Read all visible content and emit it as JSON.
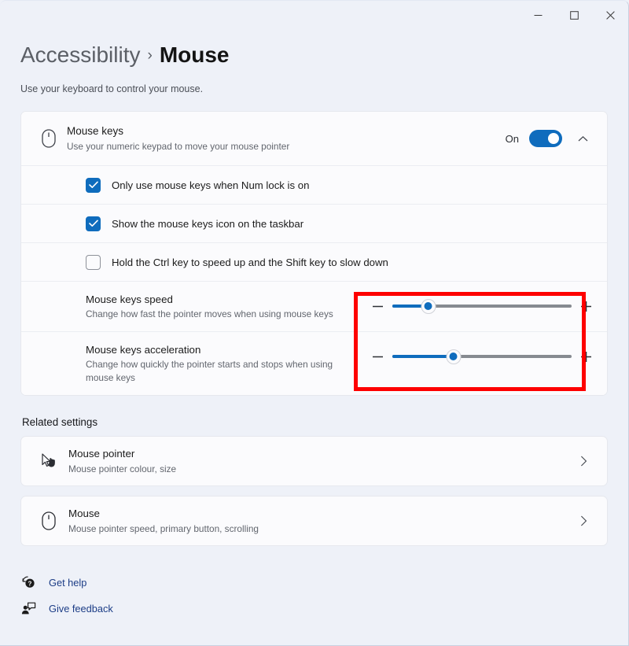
{
  "window": {
    "controls": [
      {
        "name": "minimize",
        "label": "Minimize"
      },
      {
        "name": "maximize",
        "label": "Maximize"
      },
      {
        "name": "close",
        "label": "Close"
      }
    ]
  },
  "header": {
    "breadcrumb_parent": "Accessibility",
    "breadcrumb_separator": "›",
    "breadcrumb_current": "Mouse",
    "subtitle": "Use your keyboard to control your mouse."
  },
  "mouse_keys": {
    "icon": "mouse-icon",
    "title": "Mouse keys",
    "description": "Use your numeric keypad to move your mouse pointer",
    "toggle_state_label": "On",
    "toggle_on": true,
    "expanded": true,
    "expand_icon": "chevron-up-icon",
    "checkboxes": [
      {
        "label": "Only use mouse keys when Num lock is on",
        "checked": true
      },
      {
        "label": "Show the mouse keys icon on the taskbar",
        "checked": true
      },
      {
        "label": "Hold the Ctrl key to speed up and the Shift key to slow down",
        "checked": false
      }
    ],
    "sliders": [
      {
        "title": "Mouse keys speed",
        "description": "Change how fast the pointer moves when using mouse keys",
        "value_percent": 20,
        "minus_icon": "minus-icon",
        "plus_icon": "plus-icon"
      },
      {
        "title": "Mouse keys acceleration",
        "description": "Change how quickly the pointer starts and stops when using mouse keys",
        "value_percent": 34,
        "minus_icon": "minus-icon",
        "plus_icon": "plus-icon"
      }
    ]
  },
  "annotation": {
    "color": "#fe0000",
    "label": "slider-controls-highlight"
  },
  "related": {
    "section_title": "Related settings",
    "items": [
      {
        "icon": "mouse-pointer-icon",
        "title": "Mouse pointer",
        "description": "Mouse pointer colour, size",
        "chevron": "chevron-right-icon"
      },
      {
        "icon": "mouse-icon",
        "title": "Mouse",
        "description": "Mouse pointer speed, primary button, scrolling",
        "chevron": "chevron-right-icon"
      }
    ]
  },
  "footer_links": [
    {
      "icon": "help-icon",
      "label": "Get help"
    },
    {
      "icon": "feedback-icon",
      "label": "Give feedback"
    }
  ]
}
